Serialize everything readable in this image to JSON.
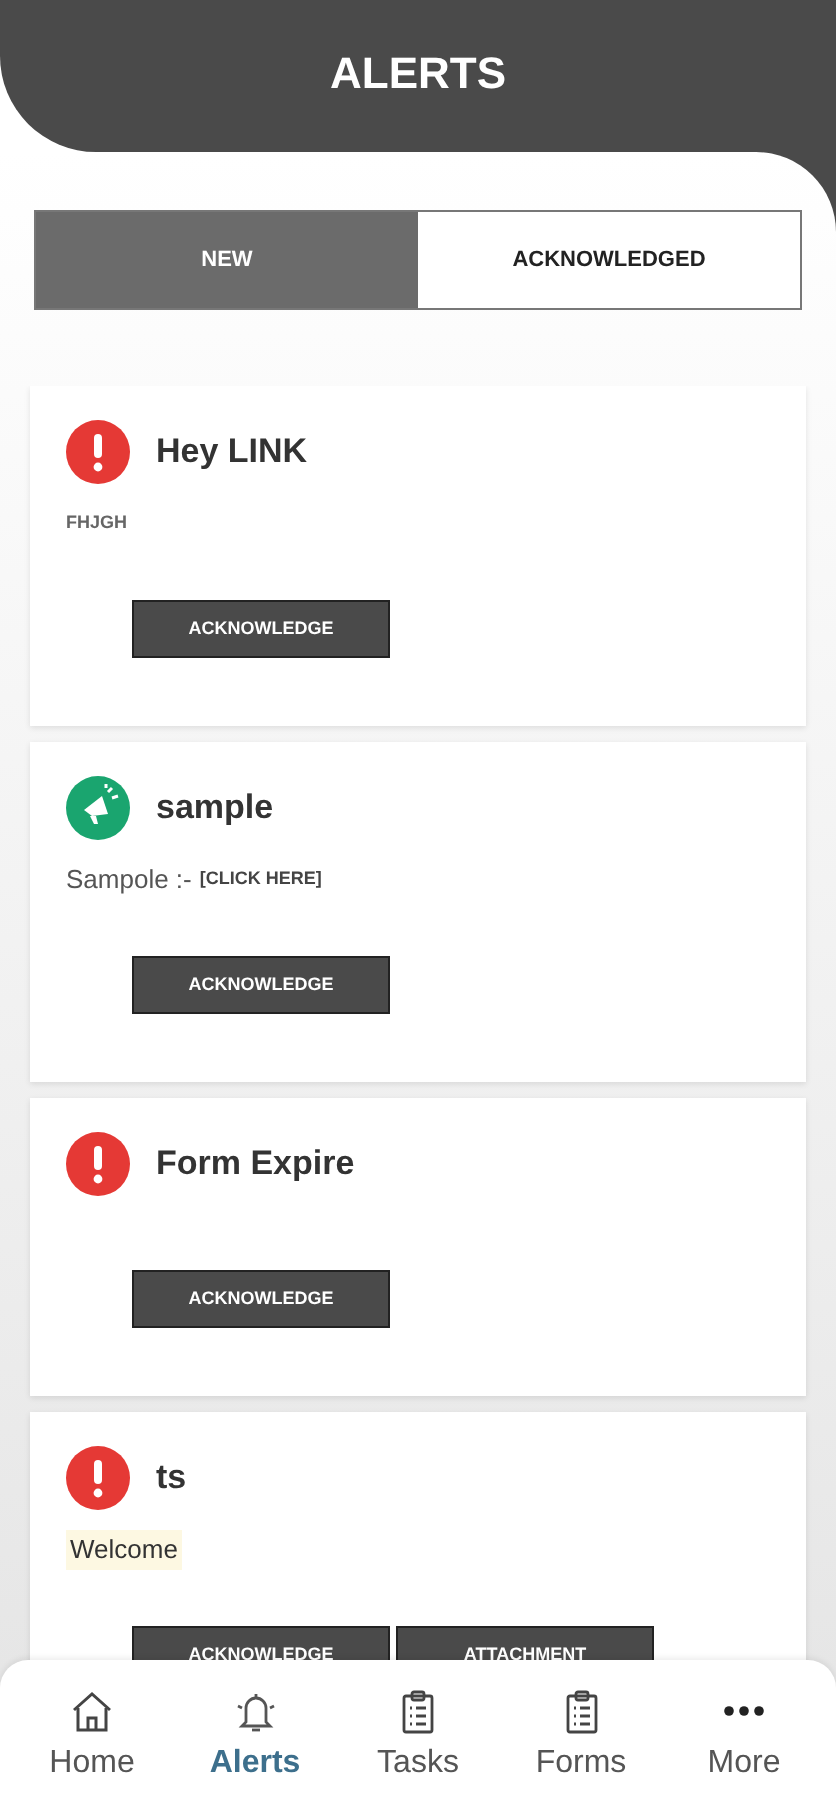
{
  "header": {
    "title": "ALERTS"
  },
  "tabs": [
    {
      "label": "NEW",
      "selected": true
    },
    {
      "label": "ACKNOWLEDGED",
      "selected": false
    }
  ],
  "alerts": [
    {
      "kind": "warning",
      "title": "Hey LINK",
      "body": [
        {
          "text": "FHJGH",
          "kind": "caps"
        }
      ],
      "buttons": [
        "ACKNOWLEDGE"
      ]
    },
    {
      "kind": "announcement",
      "title": "sample",
      "body": [
        {
          "text": "Sampole :-",
          "kind": "plain"
        },
        {
          "text": "[CLICK HERE]",
          "kind": "link"
        }
      ],
      "buttons": [
        "ACKNOWLEDGE"
      ]
    },
    {
      "kind": "warning",
      "title": "Form Expire",
      "buttons": [
        "ACKNOWLEDGE"
      ]
    },
    {
      "kind": "warning",
      "title": "ts",
      "body": [
        {
          "text": "Welcome",
          "kind": "highlight"
        }
      ],
      "buttons": [
        "ACKNOWLEDGE",
        "ATTACHMENT"
      ]
    }
  ],
  "nav": [
    {
      "kind": "home",
      "label": "Home",
      "selected": false
    },
    {
      "kind": "bell",
      "label": "Alerts",
      "selected": true
    },
    {
      "kind": "clipboard",
      "label": "Tasks",
      "selected": false
    },
    {
      "kind": "clipboard",
      "label": "Forms",
      "selected": false
    },
    {
      "kind": "dots",
      "label": "More",
      "selected": false
    }
  ]
}
